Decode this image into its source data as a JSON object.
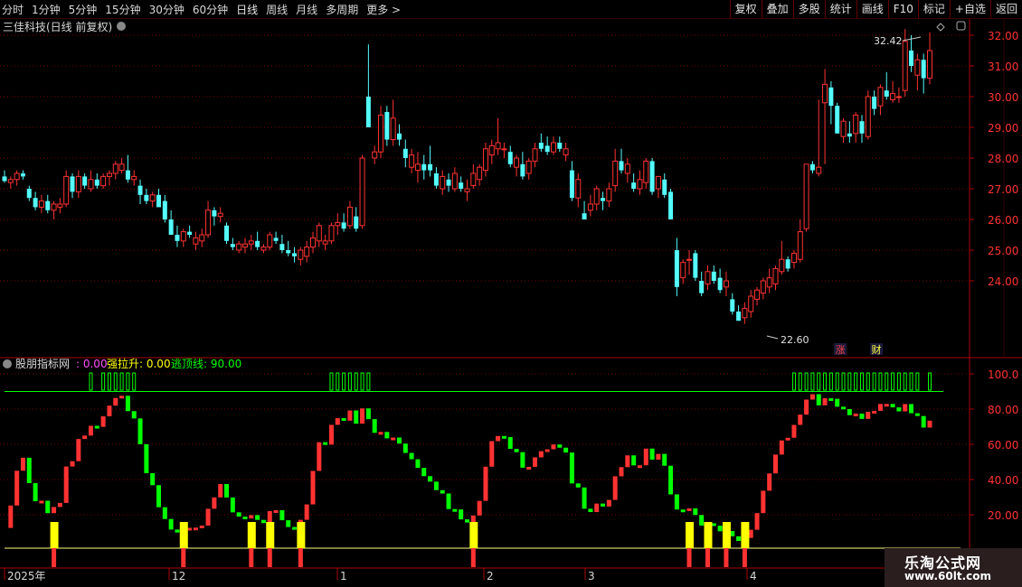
{
  "toolbar": {
    "periods": [
      "分时",
      "1分钟",
      "5分钟",
      "15分钟",
      "30分钟",
      "60分钟",
      "日线",
      "周线",
      "月线",
      "多周期",
      "更多 >"
    ],
    "active_period": "日线",
    "buttons": [
      "复权",
      "叠加",
      "多股",
      "统计",
      "画线",
      "F10",
      "标记",
      "+自选",
      "返回"
    ]
  },
  "stock_title": "三佳科技(日线 前复权)",
  "colors": {
    "up": "#ff3232",
    "down": "#54fcfc",
    "grid": "#7a0000",
    "axis": "#aa0000",
    "green": "#00ff00",
    "yellow": "#ffff00",
    "magenta": "#ff50ff",
    "white": "#e0e0e0"
  },
  "price_axis": {
    "ticks": [
      "32.00",
      "31.00",
      "30.00",
      "29.00",
      "28.00",
      "27.00",
      "26.00",
      "25.00",
      "24.00"
    ]
  },
  "annotations": {
    "high": "32.42",
    "low": "22.60",
    "zhang": "涨",
    "cai": "财"
  },
  "indicator": {
    "name": "股朋指标网",
    "value1": ": 0.00",
    "label2": "强拉升: 0.00",
    "label3": "逃顶线: 90.00",
    "ticks": [
      "100.0",
      "80.00",
      "60.00",
      "40.00",
      "20.00"
    ]
  },
  "date_axis": {
    "labels": [
      "2025年",
      "12",
      "1",
      "2",
      "3",
      "4"
    ]
  },
  "watermark": {
    "line1": "乐淘公式网",
    "line2": "www.60lt.com"
  },
  "chart_data": {
    "type": "candlestick",
    "ylim": [
      22.3,
      32.6
    ],
    "ohlc": [
      [
        27.4,
        27.6,
        27.2,
        27.25
      ],
      [
        27.2,
        27.4,
        27.0,
        27.3
      ],
      [
        27.3,
        27.6,
        27.1,
        27.5
      ],
      [
        27.5,
        27.6,
        27.3,
        27.4
      ],
      [
        27.0,
        27.1,
        26.6,
        26.7
      ],
      [
        26.7,
        26.9,
        26.3,
        26.4
      ],
      [
        26.4,
        26.8,
        26.2,
        26.6
      ],
      [
        26.6,
        26.8,
        26.2,
        26.3
      ],
      [
        26.3,
        26.6,
        26.0,
        26.5
      ],
      [
        26.4,
        26.7,
        26.2,
        26.5
      ],
      [
        26.5,
        27.6,
        26.4,
        27.4
      ],
      [
        27.4,
        27.5,
        26.7,
        26.9
      ],
      [
        26.9,
        27.6,
        26.7,
        27.4
      ],
      [
        27.4,
        27.5,
        27.0,
        27.1
      ],
      [
        27.0,
        27.6,
        26.9,
        27.3
      ],
      [
        27.3,
        27.5,
        27.0,
        27.1
      ],
      [
        27.1,
        27.5,
        27.0,
        27.4
      ],
      [
        27.4,
        27.6,
        27.1,
        27.5
      ],
      [
        27.5,
        27.9,
        27.3,
        27.8
      ],
      [
        27.6,
        28.0,
        27.5,
        27.8
      ],
      [
        27.6,
        28.1,
        27.2,
        27.3
      ],
      [
        27.3,
        27.6,
        27.1,
        27.4
      ],
      [
        27.1,
        27.3,
        26.5,
        26.8
      ],
      [
        26.8,
        27.0,
        26.5,
        26.6
      ],
      [
        26.6,
        26.9,
        26.4,
        26.8
      ],
      [
        26.8,
        27.0,
        26.5,
        26.4
      ],
      [
        26.6,
        26.8,
        25.9,
        26.0
      ],
      [
        26.0,
        26.3,
        25.5,
        25.5
      ],
      [
        25.5,
        25.8,
        25.1,
        25.3
      ],
      [
        25.3,
        25.7,
        25.1,
        25.6
      ],
      [
        25.6,
        25.8,
        25.4,
        25.5
      ],
      [
        25.2,
        25.6,
        25.0,
        25.4
      ],
      [
        25.3,
        25.7,
        25.1,
        25.5
      ],
      [
        25.5,
        26.6,
        25.4,
        26.3
      ],
      [
        26.3,
        26.4,
        25.8,
        26.1
      ],
      [
        26.1,
        26.4,
        25.9,
        26.2
      ],
      [
        25.8,
        25.9,
        25.2,
        25.3
      ],
      [
        25.2,
        25.4,
        25.0,
        25.1
      ],
      [
        25.0,
        25.3,
        24.9,
        25.2
      ],
      [
        25.1,
        25.4,
        24.9,
        25.2
      ],
      [
        25.2,
        25.5,
        25.0,
        25.3
      ],
      [
        25.3,
        25.6,
        25.0,
        25.1
      ],
      [
        25.0,
        25.2,
        24.9,
        25.1
      ],
      [
        25.1,
        25.6,
        25.0,
        25.5
      ],
      [
        25.4,
        25.6,
        25.2,
        25.3
      ],
      [
        25.2,
        25.5,
        24.9,
        25.0
      ],
      [
        25.0,
        25.3,
        24.8,
        24.9
      ],
      [
        24.9,
        25.1,
        24.6,
        24.8
      ],
      [
        24.7,
        25.1,
        24.5,
        25.0
      ],
      [
        24.8,
        25.3,
        24.6,
        25.1
      ],
      [
        25.1,
        25.6,
        24.9,
        25.4
      ],
      [
        25.3,
        25.9,
        25.1,
        25.8
      ],
      [
        25.2,
        25.5,
        25.0,
        25.3
      ],
      [
        25.3,
        25.9,
        25.2,
        25.8
      ],
      [
        25.8,
        26.2,
        25.5,
        25.9
      ],
      [
        25.9,
        26.2,
        25.6,
        25.7
      ],
      [
        25.8,
        26.6,
        25.7,
        26.4
      ],
      [
        26.1,
        26.4,
        25.6,
        25.7
      ],
      [
        25.8,
        28.1,
        25.7,
        28.0
      ],
      [
        30.0,
        31.7,
        29.0,
        29.0
      ],
      [
        28.0,
        28.4,
        27.8,
        28.2
      ],
      [
        28.2,
        29.7,
        28.0,
        29.4
      ],
      [
        29.5,
        29.7,
        28.4,
        28.6
      ],
      [
        28.6,
        29.9,
        28.4,
        29.3
      ],
      [
        28.8,
        29.1,
        28.4,
        28.6
      ],
      [
        28.3,
        28.6,
        27.7,
        28.0
      ],
      [
        27.7,
        28.3,
        27.5,
        28.1
      ],
      [
        27.6,
        28.2,
        27.2,
        27.8
      ],
      [
        27.8,
        28.1,
        27.3,
        27.6
      ],
      [
        27.8,
        28.4,
        27.4,
        27.6
      ],
      [
        27.5,
        27.7,
        27.0,
        27.1
      ],
      [
        27.0,
        27.6,
        26.8,
        27.4
      ],
      [
        27.3,
        27.5,
        26.9,
        27.1
      ],
      [
        27.0,
        27.7,
        26.9,
        27.5
      ],
      [
        27.2,
        27.4,
        26.9,
        27.0
      ],
      [
        26.9,
        27.3,
        26.6,
        27.0
      ],
      [
        27.1,
        27.8,
        27.0,
        27.5
      ],
      [
        27.3,
        27.8,
        27.1,
        27.7
      ],
      [
        27.6,
        28.5,
        27.4,
        28.3
      ],
      [
        28.1,
        28.6,
        27.8,
        28.4
      ],
      [
        28.3,
        29.3,
        28.1,
        28.5
      ],
      [
        28.3,
        28.5,
        28.0,
        28.3
      ],
      [
        28.2,
        28.4,
        27.7,
        27.8
      ],
      [
        27.7,
        28.1,
        27.4,
        28.0
      ],
      [
        27.8,
        28.2,
        27.3,
        27.4
      ],
      [
        27.5,
        28.0,
        27.3,
        27.9
      ],
      [
        27.9,
        28.5,
        27.7,
        28.3
      ],
      [
        28.5,
        28.8,
        28.2,
        28.3
      ],
      [
        28.4,
        28.7,
        28.1,
        28.2
      ],
      [
        28.2,
        28.7,
        28.1,
        28.5
      ],
      [
        28.5,
        28.7,
        28.2,
        28.3
      ],
      [
        28.1,
        28.5,
        27.9,
        28.3
      ],
      [
        27.6,
        27.9,
        26.6,
        26.7
      ],
      [
        26.7,
        27.5,
        26.4,
        27.3
      ],
      [
        26.2,
        26.6,
        26.0,
        26.0
      ],
      [
        26.3,
        26.8,
        26.1,
        26.5
      ],
      [
        26.5,
        27.1,
        26.3,
        27.0
      ],
      [
        26.7,
        26.9,
        26.3,
        26.6
      ],
      [
        26.6,
        27.2,
        26.4,
        27.0
      ],
      [
        27.1,
        28.3,
        26.9,
        27.9
      ],
      [
        27.9,
        28.3,
        27.5,
        27.6
      ],
      [
        27.5,
        28.0,
        27.2,
        27.8
      ],
      [
        27.2,
        27.5,
        26.9,
        27.0
      ],
      [
        27.0,
        27.6,
        26.8,
        27.3
      ],
      [
        27.2,
        28.0,
        27.0,
        27.9
      ],
      [
        27.9,
        28.0,
        26.8,
        26.9
      ],
      [
        27.0,
        27.4,
        26.7,
        27.4
      ],
      [
        27.3,
        27.5,
        26.7,
        26.8
      ],
      [
        26.9,
        27.0,
        26.0,
        26.0
      ],
      [
        25.0,
        25.4,
        23.5,
        23.8
      ],
      [
        24.1,
        24.7,
        23.9,
        24.6
      ],
      [
        24.7,
        25.0,
        24.2,
        24.7
      ],
      [
        24.9,
        25.0,
        24.0,
        24.1
      ],
      [
        24.0,
        24.3,
        23.5,
        23.6
      ],
      [
        23.9,
        24.5,
        23.7,
        24.3
      ],
      [
        24.3,
        24.5,
        23.9,
        24.0
      ],
      [
        24.1,
        24.4,
        23.6,
        23.7
      ],
      [
        23.8,
        24.3,
        23.5,
        24.0
      ],
      [
        23.4,
        23.6,
        22.9,
        23.0
      ],
      [
        23.0,
        23.2,
        22.7,
        22.7
      ],
      [
        22.8,
        23.3,
        22.6,
        23.1
      ],
      [
        23.0,
        23.7,
        22.8,
        23.5
      ],
      [
        23.4,
        23.8,
        23.2,
        23.7
      ],
      [
        23.6,
        24.1,
        23.4,
        24.0
      ],
      [
        23.8,
        24.4,
        23.6,
        24.1
      ],
      [
        23.9,
        24.5,
        23.7,
        24.4
      ],
      [
        24.3,
        25.3,
        24.2,
        24.7
      ],
      [
        24.7,
        24.8,
        24.3,
        24.4
      ],
      [
        24.6,
        25.0,
        24.4,
        24.9
      ],
      [
        24.7,
        26.0,
        24.6,
        25.6
      ],
      [
        25.7,
        27.7,
        25.6,
        27.8
      ],
      [
        27.8,
        27.9,
        27.5,
        27.6
      ],
      [
        27.5,
        29.9,
        27.4,
        27.7
      ],
      [
        29.8,
        30.9,
        27.8,
        30.4
      ],
      [
        30.3,
        30.5,
        29.1,
        29.7
      ],
      [
        29.7,
        29.8,
        28.8,
        28.8
      ],
      [
        28.7,
        29.3,
        28.5,
        29.2
      ],
      [
        28.8,
        29.2,
        28.5,
        28.7
      ],
      [
        28.8,
        29.5,
        28.5,
        29.4
      ],
      [
        29.2,
        29.4,
        28.5,
        28.8
      ],
      [
        28.7,
        30.2,
        28.6,
        30.0
      ],
      [
        30.0,
        30.2,
        29.4,
        29.6
      ],
      [
        29.7,
        30.4,
        29.4,
        30.3
      ],
      [
        30.2,
        30.8,
        29.9,
        30.0
      ],
      [
        29.9,
        30.5,
        29.8,
        30.1
      ],
      [
        30.0,
        30.3,
        29.8,
        30.0
      ],
      [
        30.2,
        32.2,
        30.0,
        31.8
      ],
      [
        31.5,
        32.0,
        30.8,
        31.0
      ],
      [
        30.7,
        31.4,
        30.2,
        31.2
      ],
      [
        31.2,
        31.4,
        30.1,
        30.6
      ],
      [
        30.6,
        32.1,
        30.4,
        31.5
      ]
    ]
  }
}
